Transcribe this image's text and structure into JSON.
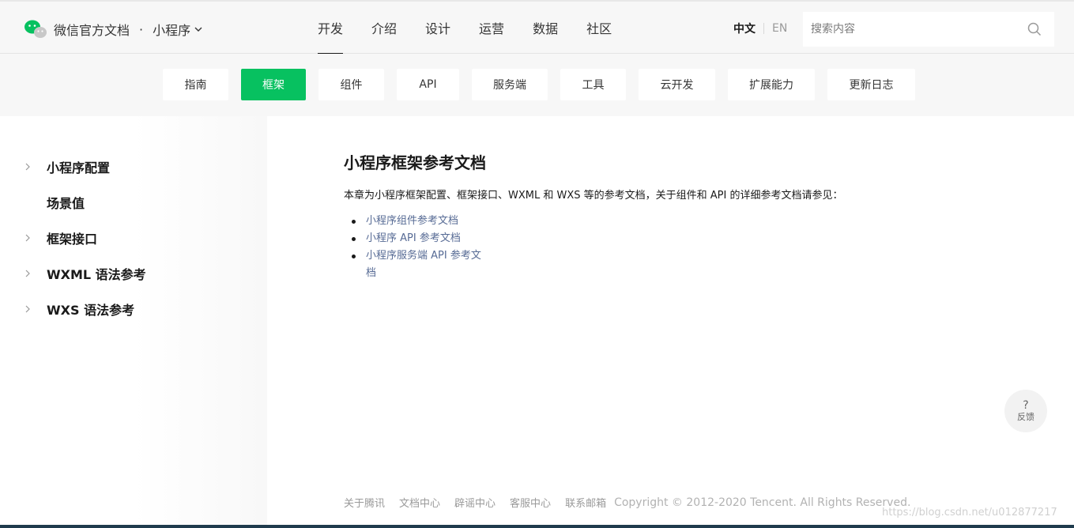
{
  "header": {
    "brand": "微信官方文档",
    "brand_dot": "·",
    "product": "小程序",
    "nav": [
      {
        "label": "开发",
        "active": true
      },
      {
        "label": "介绍"
      },
      {
        "label": "设计"
      },
      {
        "label": "运营"
      },
      {
        "label": "数据"
      },
      {
        "label": "社区"
      }
    ],
    "lang_zh": "中文",
    "lang_en": "EN",
    "search_placeholder": "搜索内容"
  },
  "tabs": [
    {
      "label": "指南"
    },
    {
      "label": "框架",
      "active": true
    },
    {
      "label": "组件"
    },
    {
      "label": "API"
    },
    {
      "label": "服务端"
    },
    {
      "label": "工具"
    },
    {
      "label": "云开发"
    },
    {
      "label": "扩展能力"
    },
    {
      "label": "更新日志"
    }
  ],
  "sidebar": {
    "items": [
      {
        "label": "小程序配置",
        "expandable": true
      },
      {
        "label": "场景值",
        "expandable": false
      },
      {
        "label": "框架接口",
        "expandable": true
      },
      {
        "label": "WXML 语法参考",
        "expandable": true
      },
      {
        "label": "WXS 语法参考",
        "expandable": true
      }
    ]
  },
  "main": {
    "title": "小程序框架参考文档",
    "intro": "本章为小程序框架配置、框架接口、WXML 和 WXS 等的参考文档，关于组件和 API 的详细参考文档请参见：",
    "links": [
      "小程序组件参考文档",
      "小程序 API 参考文档",
      "小程序服务端 API 参考文档"
    ]
  },
  "feedback": {
    "icon_text": "?",
    "label": "反馈"
  },
  "footer": {
    "links": [
      "关于腾讯",
      "文档中心",
      "辟谣中心",
      "客服中心",
      "联系邮箱"
    ],
    "copyright": "Copyright © 2012-2020 Tencent. All Rights Reserved."
  },
  "watermark": "https://blog.csdn.net/u012877217",
  "colors": {
    "accent": "#07c160",
    "link": "#576b95"
  }
}
